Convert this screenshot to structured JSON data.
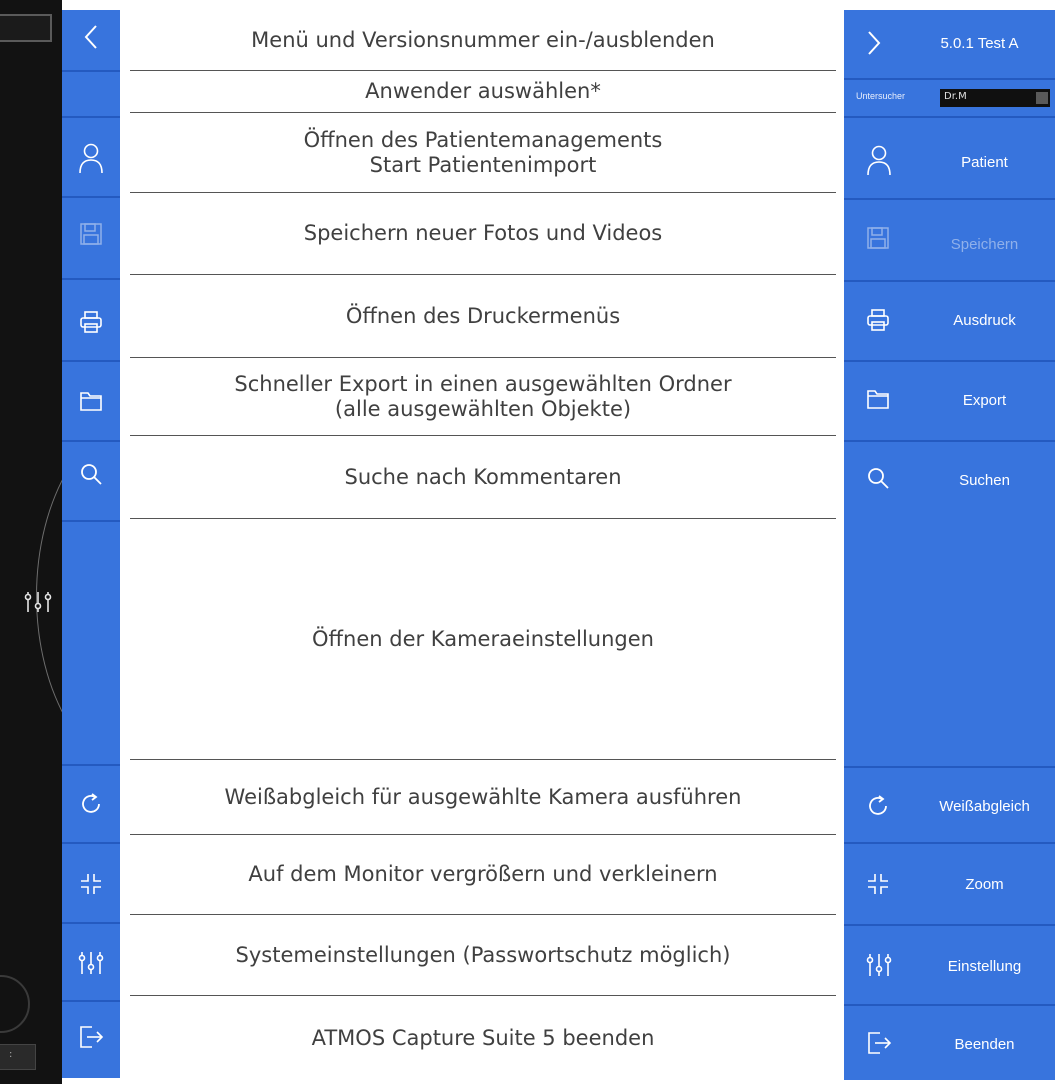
{
  "descriptions": {
    "menu_toggle": "Menü und Versionsnummer ein-/ausblenden",
    "user_select": "Anwender auswählen*",
    "patient_line1": "Öffnen des Patientemanagements",
    "patient_line2": "Start Patientenimport",
    "save": "Speichern neuer Fotos und Videos",
    "print": "Öffnen des Druckermenüs",
    "export_line1": "Schneller Export in einen ausgewählten Ordner",
    "export_line2": "(alle ausgewählten Objekte)",
    "search": "Suche nach Kommentaren",
    "camera": "Öffnen der Kameraeinstellungen",
    "whitebalance": "Weißabgleich für ausgewählte Kamera ausführen",
    "zoom": "Auf dem Monitor vergrößern und verkleinern",
    "settings": "Systemeinstellungen (Passwortschutz möglich)",
    "exit": "ATMOS Capture Suite 5 beenden"
  },
  "wide_menu": {
    "version": "5.0.1 Test A",
    "user_label": "Untersucher",
    "user_value": "Dr.M",
    "patient": "Patient",
    "save": "Speichern",
    "print": "Ausdruck",
    "export": "Export",
    "search": "Suchen",
    "whitebalance": "Weißabgleich",
    "zoom": "Zoom",
    "settings": "Einstellung",
    "exit": "Beenden"
  },
  "colors": {
    "menu_blue": "#3874dd",
    "separator_blue": "#245ac0"
  }
}
